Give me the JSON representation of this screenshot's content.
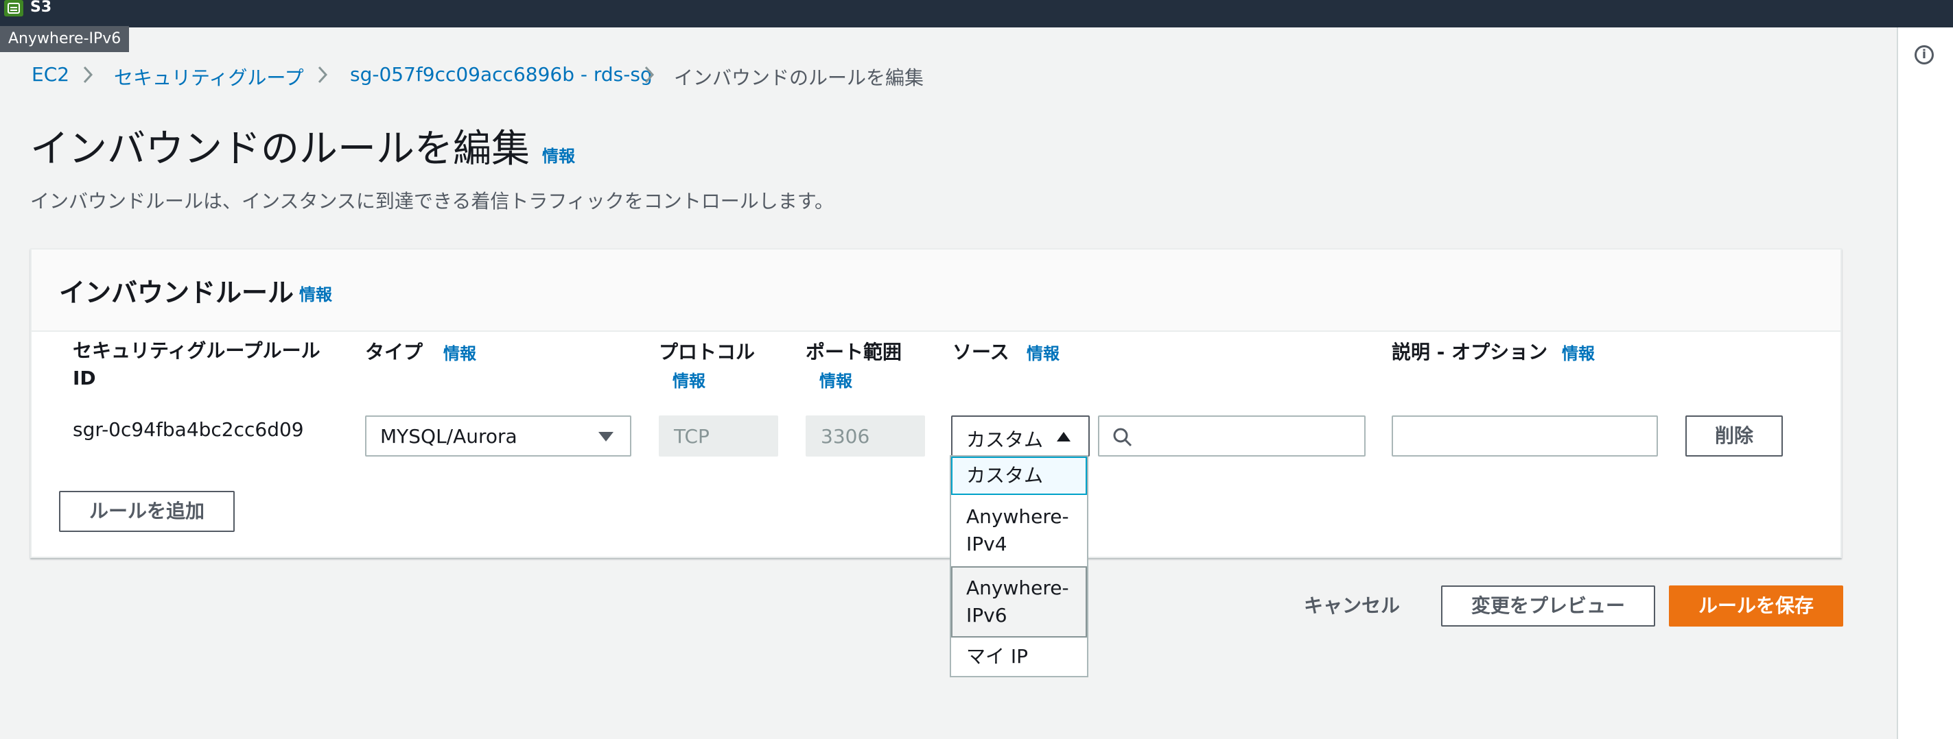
{
  "topbar": {
    "app_label": "S3",
    "tooltip": "Anywhere-IPv6"
  },
  "breadcrumb": [
    "EC2",
    "セキュリティグループ",
    "sg-057f9cc09acc6896b - rds-sg",
    "インバウンドのルールを編集"
  ],
  "page": {
    "title": "インバウンドのルールを編集",
    "info": "情報",
    "description": "インバウンドルールは、インスタンスに到達できる着信トラフィックをコントロールします。"
  },
  "panel": {
    "title": "インバウンドルール",
    "info": "情報",
    "columns": {
      "rule_id": "セキュリティグループルール ID",
      "type": "タイプ",
      "protocol": "プロトコル",
      "port_range": "ポート範囲",
      "source": "ソース",
      "description": "説明 - オプション"
    },
    "column_info": "情報",
    "rows": [
      {
        "rule_id": "sgr-0c94fba4bc2cc6d09",
        "type": "MYSQL/Aurora",
        "protocol": "TCP",
        "port_range": "3306",
        "source_type": "カスタム",
        "source_value": "",
        "description": "",
        "delete_label": "削除"
      }
    ],
    "add_rule_label": "ルールを追加"
  },
  "source_dropdown": {
    "options": [
      "カスタム",
      "Anywhere-IPv4",
      "Anywhere-IPv6",
      "マイ IP"
    ],
    "focused": "カスタム",
    "hovered": "Anywhere-IPv6"
  },
  "footer": {
    "cancel": "キャンセル",
    "preview": "変更をプレビュー",
    "save": "ルールを保存"
  },
  "colors": {
    "topbar": "#232f3e",
    "link": "#0073bb",
    "primary": "#ec7211",
    "background": "#f2f3f3",
    "s3_icon": "#3f8624"
  },
  "icons": [
    "s3-icon",
    "info-circle-icon",
    "chevron-right-icon",
    "caret-down-icon",
    "caret-up-icon",
    "search-icon"
  ]
}
